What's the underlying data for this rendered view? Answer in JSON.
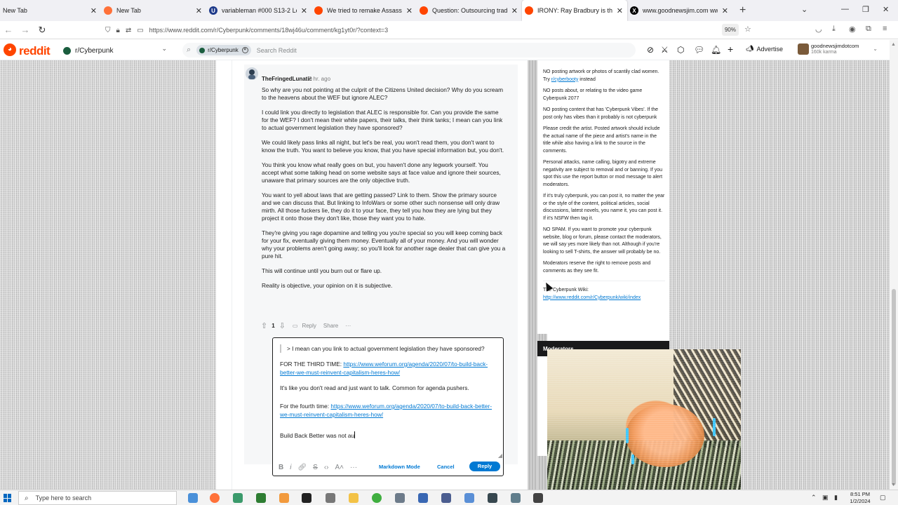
{
  "browser": {
    "tabs": [
      {
        "label": "New Tab",
        "icon": "blank-page-icon",
        "color": "#ffffff"
      },
      {
        "label": "New Tab",
        "icon": "firefox-icon",
        "color": "#ff7139"
      },
      {
        "label": "variableman #000 S13-2 LoL Pr",
        "icon": "rumble-u-icon",
        "color": "#1e3a8a"
      },
      {
        "label": "We tried to remake Assassin's C",
        "icon": "reddit-icon",
        "color": "#ff4500"
      },
      {
        "label": "Question: Outsourcing trading",
        "icon": "reddit-icon",
        "color": "#ff4500"
      },
      {
        "label": "IRONY: Ray Bradbury is the aut",
        "icon": "reddit-icon",
        "color": "#ff4500"
      },
      {
        "label": "www.goodnewsjim.com www.",
        "icon": "x-icon",
        "color": "#000000"
      }
    ],
    "url": "https://www.reddit.com/r/Cyberpunk/comments/18wj46u/comment/kg1yt0r/?context=3",
    "zoom": "90%"
  },
  "reddit": {
    "logo_text": "reddit",
    "subreddit": "r/Cyberpunk",
    "search_chip": "r/Cyberpunk",
    "search_placeholder": "Search Reddit",
    "advertise": "Advertise",
    "username": "goodnewsjimdotcom",
    "karma": "160k karma"
  },
  "comment": {
    "author": "TheFringedLunatic",
    "time": "· 2 hr. ago",
    "paragraphs": [
      "So why are you not pointing at the culprit of the Citizens United decision? Why do you scream to the heavens about the WEF but ignore ALEC?",
      "I could link you directly to legislation that ALEC is responsible for. Can you provide the same for the WEF? I don't mean their white papers, their talks, their think tanks; I mean can you link to actual government legislation they have sponsored?",
      "We could likely pass links all night, but let's be real, you won't read them, you don't want to know the truth. You want to believe you know, that you have special information but, you don't.",
      "You think you know what really goes on but, you haven't done any legwork yourself. You accept what some talking head on some website says at face value and ignore their sources, unaware that primary sources are the only objective truth.",
      "You want to yell about laws that are getting passed? Link to them. Show the primary source and we can discuss that. But linking to InfoWars or some other such nonsense will only draw mirth. All those fuckers lie, they do it to your face, they tell you how they are lying but they project it onto those they don't like, those they want you to hate.",
      "They're giving you rage dopamine and telling you you're special so you will keep coming back for your fix, eventually giving them money. Eventually all of your money. And you will wonder why your problems aren't going away; so you'll look for another rage dealer that can give you a pure hit.",
      "This will continue until you burn out or flare up.",
      "Reality is objective, your opinion on it is subjective."
    ],
    "vote_count": "1",
    "reply_label": "Reply",
    "share_label": "Share",
    "more_label": "···"
  },
  "editor": {
    "quote": "> I mean can you link to actual government legislation they have sponsored?",
    "line1_prefix": "FOR THE THIRD TIME: ",
    "link1": "https://www.weforum.org/agenda/2020/07/to-build-back-better-we-must-reinvent-capitalism-heres-how/",
    "line2": "It's like you don't read and just want to talk. Common for agenda pushers.",
    "line3_prefix": "For the fourth time: ",
    "link2": "https://www.weforum.org/agenda/2020/07/to-build-back-better-we-must-reinvent-capitalism-heres-how/",
    "typing": "Build Back Better was not au",
    "markdown_mode": "Markdown Mode",
    "cancel": "Cancel",
    "reply": "Reply"
  },
  "sidebar": {
    "rules": [
      "NO posting artwork or photos of scantily clad women. Try r/cyberbooty instead",
      "NO posts about, or relating to the video game Cyberpunk 2077",
      "NO posting content that has 'Cyberpunk Vibes'. If the post only has vibes than it probably is not cyberpunk",
      "Please credit the artist. Posted artwork should include the actual name of the piece and artist's name in the title while also having a link to the source in the comments.",
      "Personal attacks, name calling, bigotry and extreme negativity are subject to removal and or banning. If you spot this use the report button or mod message to alert moderators.",
      "If it's truly cyberpunk, you can post it, no matter the year or the style of the content, political articles, social discussions, latest novels, you name it, you can post it. If it's NSFW then tag it.",
      "NO SPAM. If you want to promote your cyberpunk website, blog or forum, please contact the moderators, we will say yes more likely than not. Although if you're looking to sell T-shirts, the answer will probably be no.",
      "Moderators reserve the right to remove posts and comments as they see fit."
    ],
    "wiki_prefix": "The Cyberpunk Wiki: ",
    "wiki_link": "http://www.reddit.com/r/Cyberpunk/wiki/index",
    "moderators_title": "Moderators"
  },
  "taskbar": {
    "search_placeholder": "Type here to search",
    "time": "8:51 PM",
    "date": "1/2/2024"
  },
  "colors": {
    "reddit_orange": "#ff4500",
    "link_blue": "#0079d3",
    "reply_button": "#0079d3"
  }
}
